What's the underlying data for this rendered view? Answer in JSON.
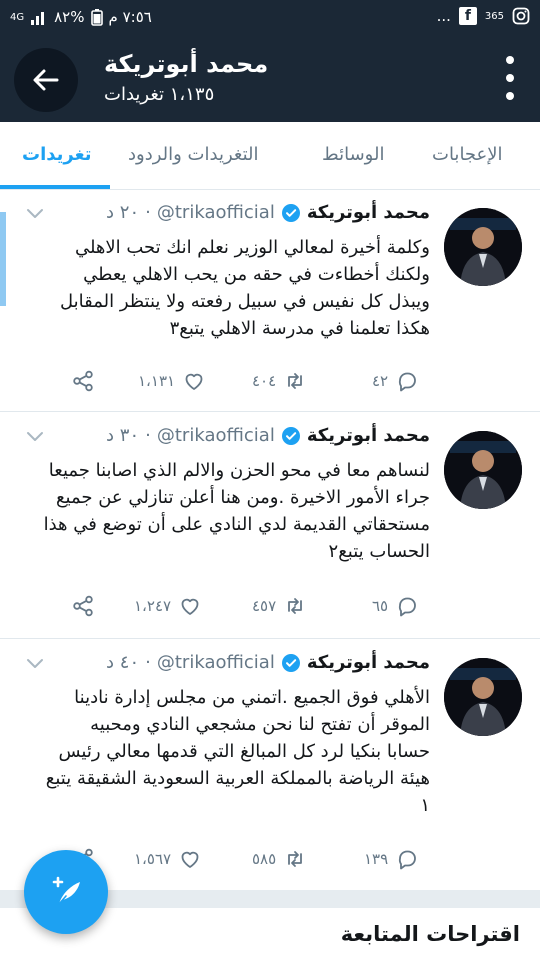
{
  "status_bar": {
    "time": "٧:٥٦ م",
    "battery": "%٨٢",
    "network": "4G",
    "dots": "...",
    "app_badge": "365"
  },
  "header": {
    "name": "محمد أبوتريكة",
    "tweet_count": "١،١٣٥ تغريدات"
  },
  "tabs": [
    {
      "label": "تغريدات",
      "active": true
    },
    {
      "label": "التغريدات والردود",
      "active": false
    },
    {
      "label": "الوسائط",
      "active": false
    },
    {
      "label": "الإعجابات",
      "active": false
    }
  ],
  "tweets": [
    {
      "name": "محمد أبوتريكة",
      "handle": "@trikaofficial",
      "time": "٢٠ د",
      "lines": [
        "وكلمة أخيرة لمعالي الوزير نعلم انك تحب الاهلي",
        "ولكنك أخطاءت في حقه من يحب الاهلي يعطي",
        "ويبذل كل نفيس في سبيل رفعته ولا ينتظر المقابل",
        "هكذا تعلمنا في مدرسة الاهلي يتبع٣"
      ],
      "replies": "٤٢",
      "retweets": "٤٠٤",
      "likes": "١،١٣١"
    },
    {
      "name": "محمد أبوتريكة",
      "handle": "@trikaofficial",
      "time": "٣٠ د",
      "lines": [
        "لنساهم معا في محو الحزن والالم الذي اصابنا جميعا",
        "جراء الأمور الاخيرة .ومن هنا أعلن تنازلي عن جميع",
        "مستحقاتي القديمة لدي النادي على أن توضع في هذا",
        "الحساب يتبع٢"
      ],
      "replies": "٦٥",
      "retweets": "٤٥٧",
      "likes": "١،٢٤٧"
    },
    {
      "name": "محمد أبوتريكة",
      "handle": "@trikaofficial",
      "time": "٤٠ د",
      "lines": [
        "الأهلي فوق الجميع .اتمني من مجلس إدارة نادينا",
        "الموقر أن تفتح لنا نحن مشجعي النادي ومحبيه",
        "حسابا بنكيا لرد كل المبالغ التي قدمها معالي رئيس",
        "هيئة الرياضة بالمملكة العربية السعودية الشقيقة يتبع",
        "١"
      ],
      "replies": "١٣٩",
      "retweets": "٥٨٥",
      "likes": "١،٥٦٧"
    }
  ],
  "suggestions": {
    "title": "اقتراحات المتابعة"
  },
  "colors": {
    "header_bg": "#1b2836",
    "accent": "#1da1f2",
    "muted": "#657786"
  }
}
